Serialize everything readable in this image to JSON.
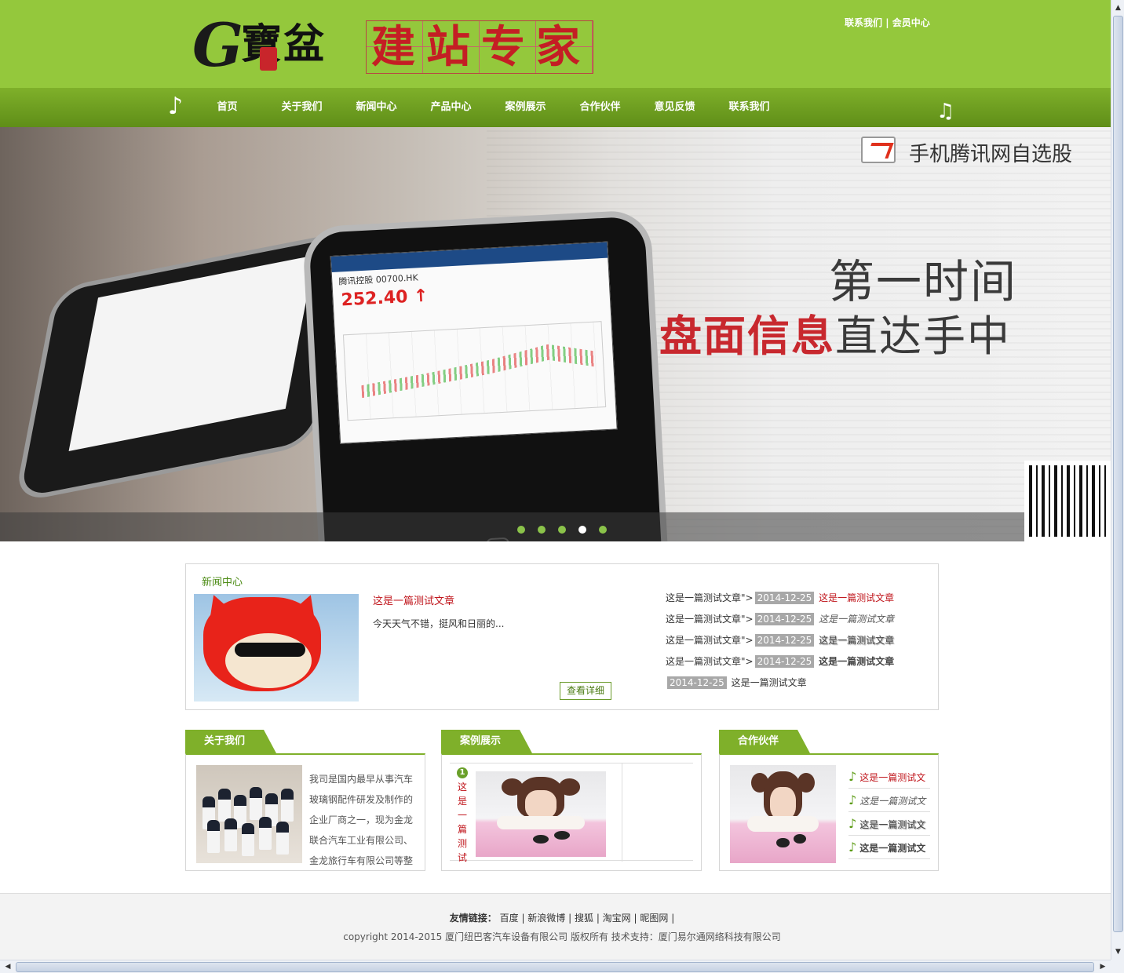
{
  "header": {
    "logo_brand": "G寶盆",
    "logo_title": "建站专家",
    "toplinks": {
      "contact": "联系我们",
      "separator": "|",
      "member": "会员中心"
    }
  },
  "nav": {
    "items": [
      "首页",
      "关于我们",
      "新闻中心",
      "产品中心",
      "案例展示",
      "合作伙伴",
      "意见反馈",
      "联系我们"
    ],
    "note_left": "♪",
    "note_right": "♫"
  },
  "banner": {
    "app_title": "手机腾讯网自选股",
    "headline1": "第一时间",
    "headline2_red": "盘面信息",
    "headline2_dark": "直达手中",
    "stock_name": "腾讯控股 00700.HK",
    "stock_price": "252.40 ↑",
    "slides": 5,
    "active_slide": 4
  },
  "news": {
    "title": "新闻中心",
    "article_title": "这是一篇测试文章",
    "article_desc": "今天天气不错，挺风和日丽的...",
    "detail_button": "查看详细",
    "list": [
      {
        "prefix": "这是一篇测试文章\">",
        "date": "2014-12-25",
        "link": "这是一篇测试文章"
      },
      {
        "prefix": "这是一篇测试文章\">",
        "date": "2014-12-25",
        "link": "这是一篇测试文章"
      },
      {
        "prefix": "这是一篇测试文章\">",
        "date": "2014-12-25",
        "link": "这是一篇测试文章"
      },
      {
        "prefix": "这是一篇测试文章\">",
        "date": "2014-12-25",
        "link": "这是一篇测试文章"
      },
      {
        "prefix": "",
        "date": "2014-12-25",
        "link": "这是一篇测试文章"
      }
    ]
  },
  "about": {
    "tab": "关于我们",
    "text": "我司是国内最早从事汽车玻璃钢配件研发及制作的企业厂商之一，现为金龙联合汽车工业有限公司、金龙旅行车有限公司等整"
  },
  "cases": {
    "tab": "案例展示",
    "item_number": "1",
    "item_title": "这是一篇测试"
  },
  "partners": {
    "tab": "合作伙伴",
    "items": [
      "这是一篇测试文",
      "这是一篇测试文",
      "这是一篇测试文",
      "这是一篇测试文"
    ]
  },
  "footer": {
    "links_label": "友情链接：",
    "links": [
      "百度",
      "新浪微博",
      "搜狐",
      "淘宝网",
      "昵图网"
    ],
    "copyright": "copyright 2014-2015 厦门纽巴客汽车设备有限公司 版权所有 技术支持：厦门易尔通网络科技有限公司"
  },
  "colors": {
    "header_green": "#94c83c",
    "nav_green": "#6a9c20",
    "accent_red": "#c0161c",
    "date_badge": "#a8a8a8"
  }
}
